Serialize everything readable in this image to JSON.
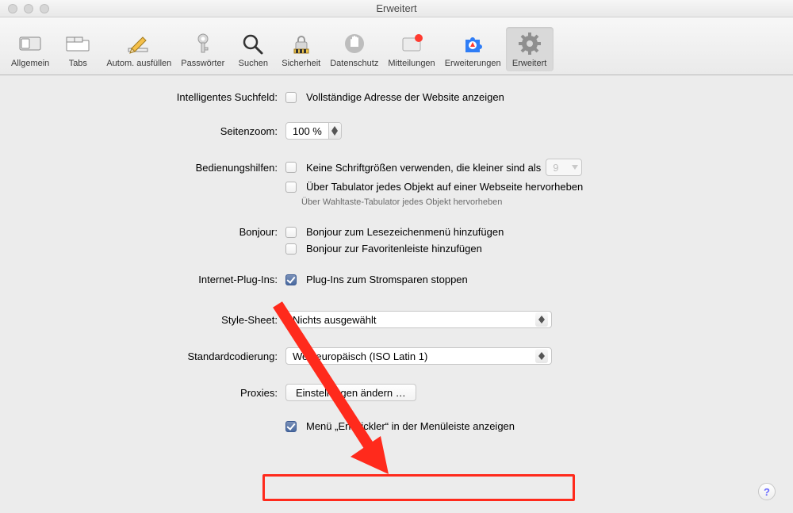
{
  "window": {
    "title": "Erweitert"
  },
  "toolbar": {
    "items": [
      {
        "label": "Allgemein"
      },
      {
        "label": "Tabs"
      },
      {
        "label": "Autom. ausfüllen"
      },
      {
        "label": "Passwörter"
      },
      {
        "label": "Suchen"
      },
      {
        "label": "Sicherheit"
      },
      {
        "label": "Datenschutz"
      },
      {
        "label": "Mitteilungen"
      },
      {
        "label": "Erweiterungen"
      },
      {
        "label": "Erweitert"
      }
    ]
  },
  "sections": {
    "smartSearch": {
      "label": "Intelligentes Suchfeld:",
      "cb1": "Vollständige Adresse der Website anzeigen"
    },
    "zoom": {
      "label": "Seitenzoom:",
      "value": "100 %"
    },
    "accessibility": {
      "label": "Bedienungshilfen:",
      "cb1": "Keine Schriftgrößen verwenden, die kleiner sind als",
      "cb1_value": "9",
      "cb2": "Über Tabulator jedes Objekt auf einer Webseite hervorheben",
      "note": "Über Wahltaste-Tabulator jedes Objekt hervorheben"
    },
    "bonjour": {
      "label": "Bonjour:",
      "cb1": "Bonjour zum Lesezeichenmenü hinzufügen",
      "cb2": "Bonjour zur Favoritenleiste hinzufügen"
    },
    "plugins": {
      "label": "Internet-Plug-Ins:",
      "cb1": "Plug-Ins zum Stromsparen stoppen"
    },
    "stylesheet": {
      "label": "Style-Sheet:",
      "value": "Nichts ausgewählt"
    },
    "encoding": {
      "label": "Standardcodierung:",
      "value": "Westeuropäisch (ISO Latin 1)"
    },
    "proxies": {
      "label": "Proxies:",
      "button": "Einstellungen ändern …"
    },
    "developer": {
      "cb1": "Menü „Entwickler“ in der Menüleiste anzeigen"
    }
  },
  "help": "?"
}
